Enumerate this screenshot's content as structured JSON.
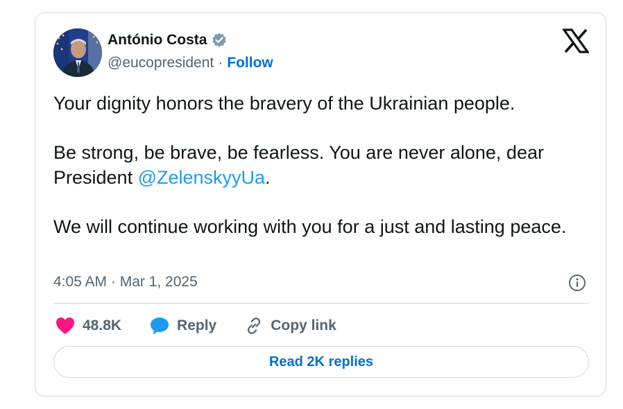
{
  "author": {
    "display_name": "António Costa",
    "handle": "@eucopresident",
    "separator": "·",
    "follow_label": "Follow",
    "verified_icon": "verified-badge-icon",
    "verified_color": "#829aab"
  },
  "brand": {
    "logo_icon": "x-logo-icon"
  },
  "tweet": {
    "paragraphs": {
      "p1": "Your dignity honors the bravery of the Ukrainian people.",
      "p2_before": "Be strong, be brave, be fearless. You are never alone, dear President ",
      "p2_mention": "@ZelenskyyUa",
      "p2_after": ".",
      "p3": "We will continue working with you for a just and lasting peace."
    },
    "timestamp": "4:05 AM · Mar 1, 2025"
  },
  "actions": {
    "like_count": "48.8K",
    "reply_label": "Reply",
    "copy_link_label": "Copy link"
  },
  "footer": {
    "read_replies_label": "Read 2K replies"
  },
  "colors": {
    "text": "#0f1419",
    "muted": "#536471",
    "link": "#006fd6",
    "mention": "#1d9bf0",
    "heart": "#f91880",
    "reply": "#1d9bf0",
    "border": "#cfd9de"
  }
}
